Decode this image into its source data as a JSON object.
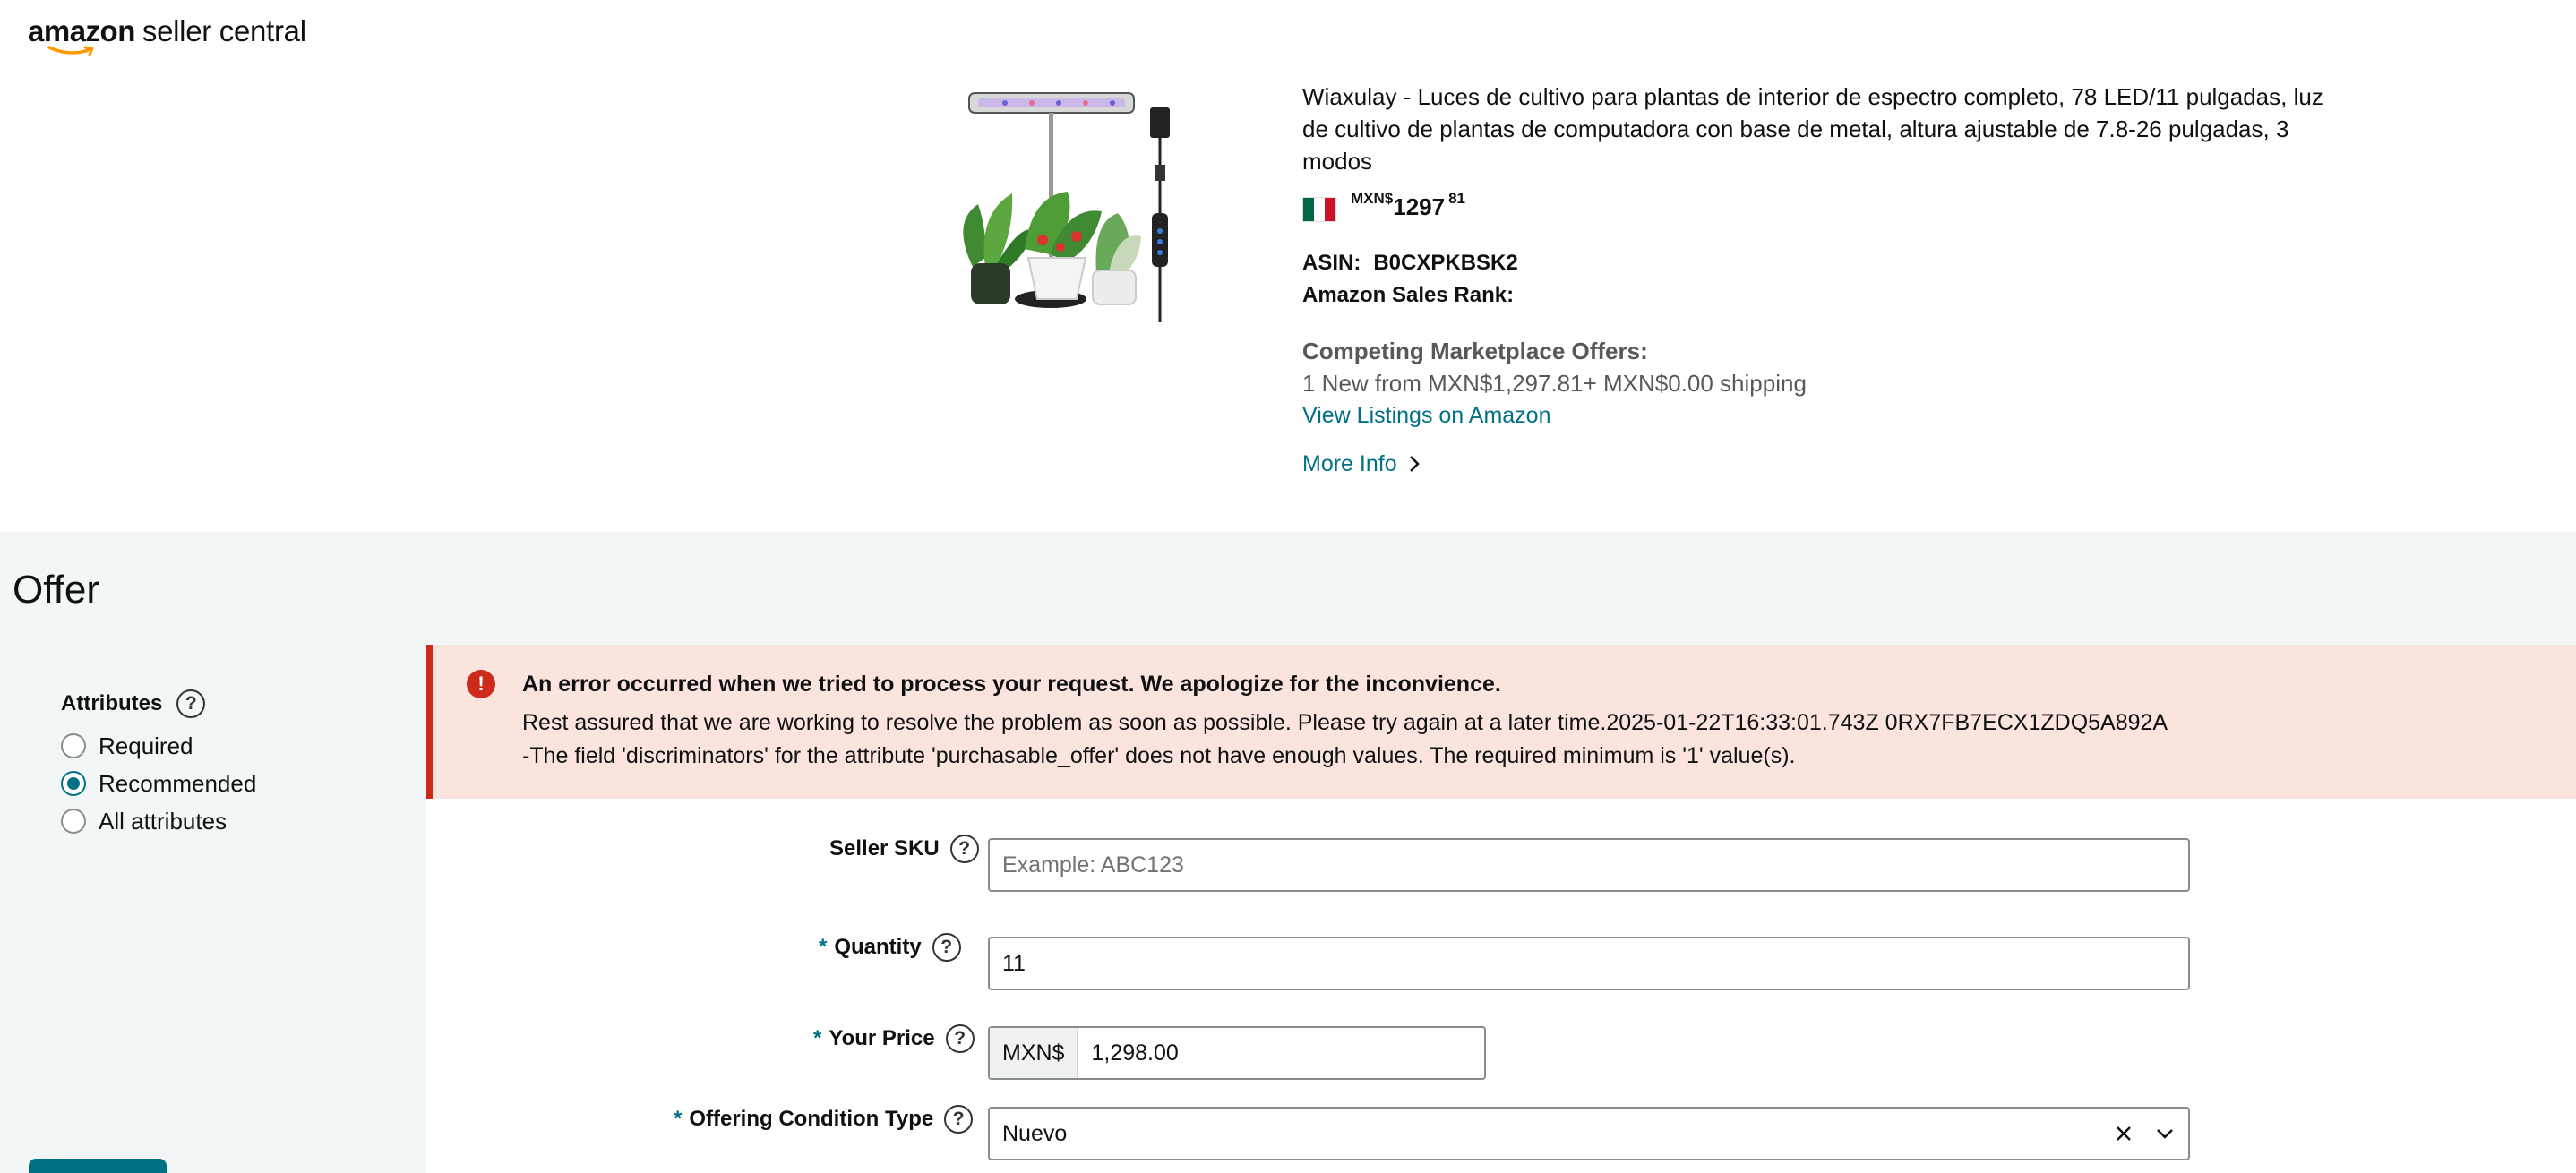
{
  "header": {
    "logo_word_amazon": "amazon",
    "logo_word_sc": "seller central"
  },
  "product": {
    "title": "Wiaxulay - Luces de cultivo para plantas de interior de espectro completo, 78 LED/11 pulgadas, luz de cultivo de plantas de computadora con base de metal, altura ajustable de 7.8-26 pulgadas, 3 modos",
    "price_currency": "MXN$",
    "price_whole": "1297",
    "price_fraction": "81",
    "asin_label": "ASIN:",
    "asin_value": "B0CXPKBSK2",
    "sales_rank_label": "Amazon Sales Rank:",
    "competing_label": "Competing Marketplace Offers:",
    "competing_value": "1 New  from MXN$1,297.81+ MXN$0.00 shipping",
    "view_listings_link": "View Listings on Amazon",
    "more_info_link": "More Info"
  },
  "offer": {
    "title": "Offer",
    "attributes": {
      "label": "Attributes",
      "options": [
        {
          "label": "Required",
          "checked": false
        },
        {
          "label": "Recommended",
          "checked": true
        },
        {
          "label": "All attributes",
          "checked": false
        }
      ]
    },
    "error": {
      "heading": "An error occurred when we tried to process your request. We apologize for the inconvience.",
      "line1": "Rest assured that we are working to resolve the problem as soon as possible. Please try again at a later time.2025-01-22T16:33:01.743Z 0RX7FB7ECX1ZDQ5A892A",
      "line2": "-The field 'discriminators' for the attribute 'purchasable_offer' does not have enough values. The required minimum is '1' value(s)."
    },
    "fields": {
      "seller_sku": {
        "label": "Seller SKU",
        "placeholder": "Example: ABC123",
        "value": ""
      },
      "quantity": {
        "label": "Quantity",
        "value": "11",
        "required_mark": "*"
      },
      "your_price": {
        "label": "Your Price",
        "currency": "MXN$",
        "value": "1,298.00",
        "required_mark": "*"
      },
      "condition": {
        "label": "Offering Condition Type",
        "value": "Nuevo",
        "required_mark": "*"
      }
    }
  },
  "colors": {
    "link": "#007185",
    "error_border": "#cc2a1a",
    "error_bg": "#fce4de",
    "section_bg": "#f3f6f6"
  }
}
